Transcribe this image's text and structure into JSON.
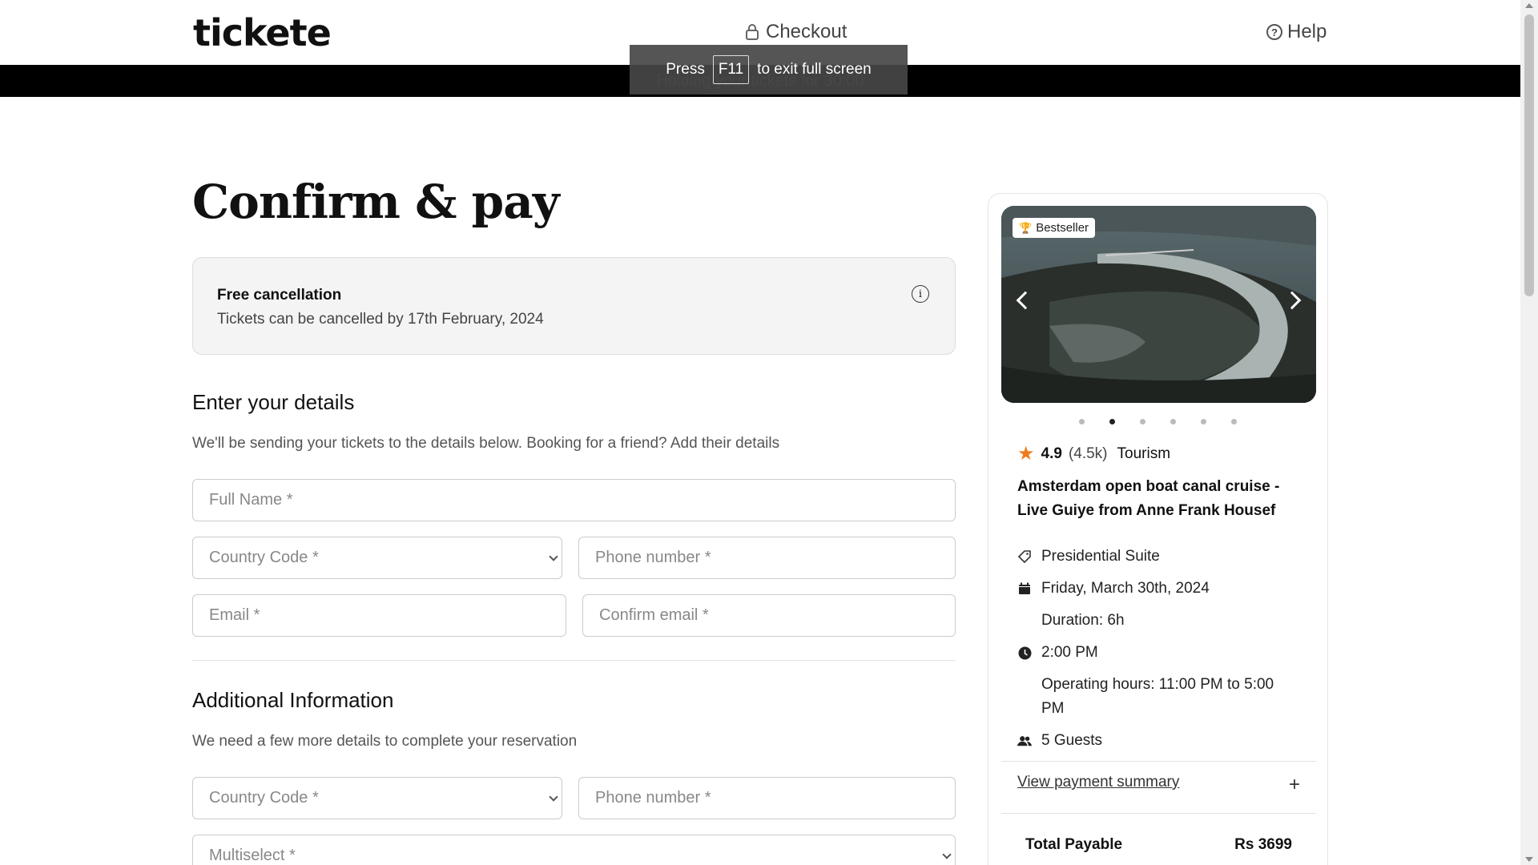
{
  "header": {
    "logo": "tickete",
    "checkout_label": "Checkout",
    "help_label": "Help",
    "help_icon_glyph": "?"
  },
  "timer": {
    "text": "Holding your tickets for 30:00"
  },
  "fullscreen_toast": {
    "press": "Press",
    "key": "F11",
    "rest": "to exit full screen"
  },
  "main": {
    "title": "Confirm & pay",
    "cancellation": {
      "title": "Free cancellation",
      "subtitle": "Tickets can be cancelled by 17th February, 2024",
      "info_glyph": "i"
    },
    "details_section": {
      "title": "Enter your details",
      "subtitle": "We'll be sending your tickets to the details below. Booking for a friend? Add their details",
      "fields": {
        "full_name": "Full Name *",
        "country_code": "Country Code *",
        "phone": "Phone number *",
        "email": "Email *",
        "confirm_email": "Confirm email *"
      }
    },
    "additional_section": {
      "title": "Additional Information",
      "subtitle": "We need a few more details to complete your reservation",
      "fields": {
        "country_code": "Country Code *",
        "phone": "Phone number *",
        "multiselect": "Multiselect *"
      }
    }
  },
  "card": {
    "badge": "Bestseller",
    "carousel_active_index": 1,
    "carousel_count": 6,
    "rating": "4.9",
    "rating_count": "(4.5k)",
    "category": "Tourism",
    "tour_title": "Amsterdam open boat canal cruise - Live Guiye from Anne Frank Housef",
    "details": {
      "ticket_type": "Presidential Suite",
      "date": "Friday, March 30th, 2024",
      "duration": "Duration: 6h",
      "time": "2:00 PM",
      "operating_hours": "Operating hours: 11:00 PM to 5:00 PM",
      "guests": "5 Guests"
    },
    "view_summary": "View payment summary",
    "plus_glyph": "+",
    "total_label": "Total Payable",
    "total_value": "Rs 3699"
  },
  "colors": {
    "accent_star": "#f07a1a",
    "timer_bar": "#000000",
    "cancel_box_bg": "#f4f4f4"
  }
}
